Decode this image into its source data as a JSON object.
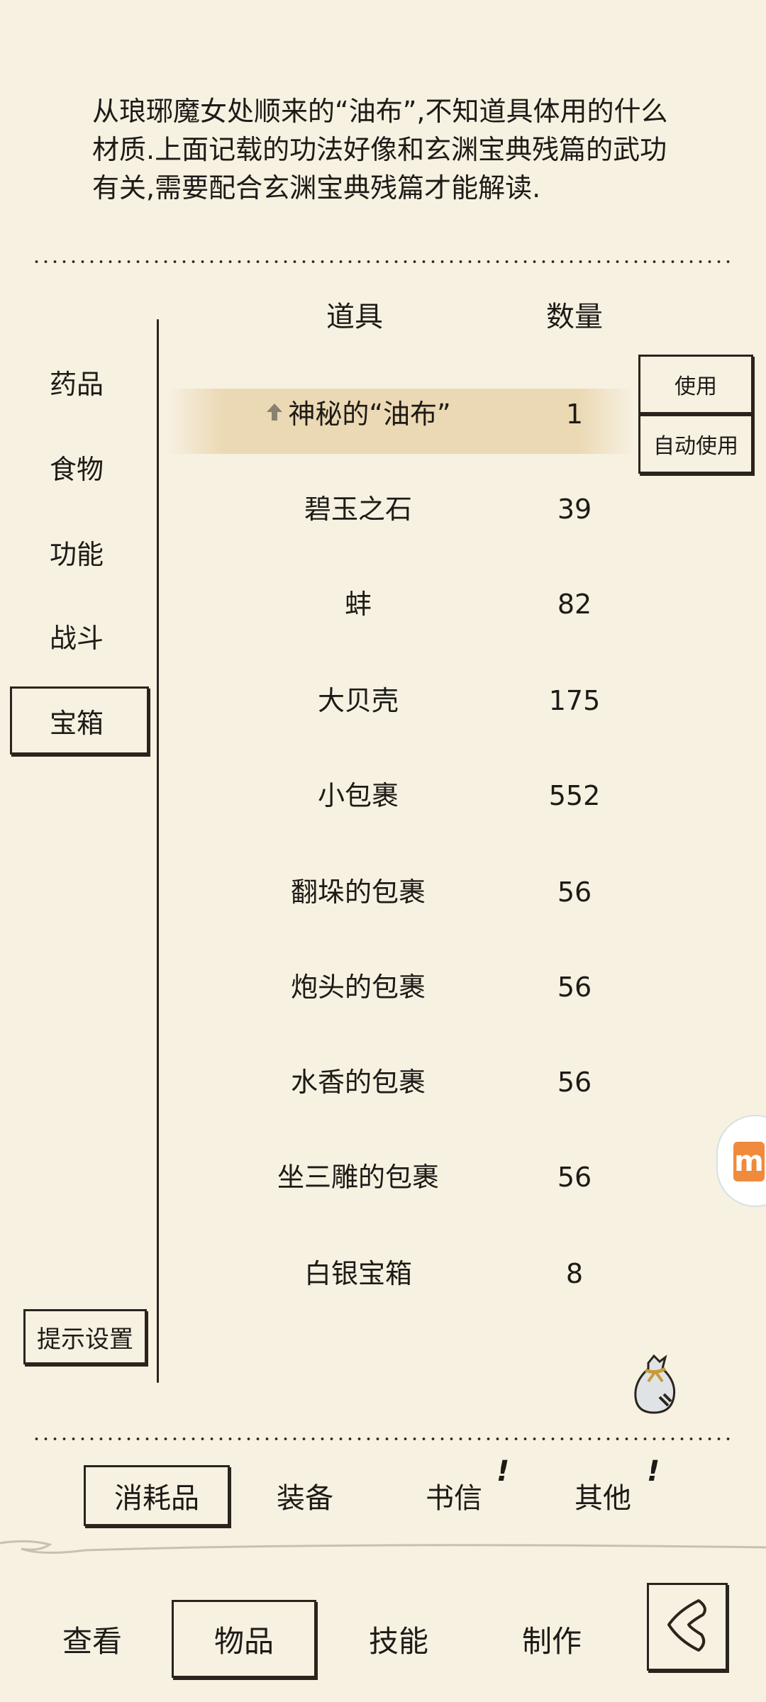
{
  "item_description": "从琅琊魔女处顺来的“油布”,不知道具体用的什么材质.上面记载的功法好像和玄渊宝典残篇的武功有关,需要配合玄渊宝典残篇才能解读.",
  "categories": [
    {
      "label": "药品"
    },
    {
      "label": "食物"
    },
    {
      "label": "功能"
    },
    {
      "label": "战斗"
    },
    {
      "label": "宝箱"
    }
  ],
  "selected_category": "宝箱",
  "hint_settings_label": "提示设置",
  "table": {
    "headers": {
      "name": "道具",
      "quantity": "数量"
    },
    "rows": [
      {
        "name": "神秘的“油布”",
        "quantity": "1"
      },
      {
        "name": "碧玉之石",
        "quantity": "39"
      },
      {
        "name": "蚌",
        "quantity": "82"
      },
      {
        "name": "大贝壳",
        "quantity": "175"
      },
      {
        "name": "小包裹",
        "quantity": "552"
      },
      {
        "name": "翻垛的包裹",
        "quantity": "56"
      },
      {
        "name": "炮头的包裹",
        "quantity": "56"
      },
      {
        "name": "水香的包裹",
        "quantity": "56"
      },
      {
        "name": "坐三雕的包裹",
        "quantity": "56"
      },
      {
        "name": "白银宝箱",
        "quantity": "8"
      }
    ]
  },
  "actions": {
    "use_label": "使用",
    "auto_use_label": "自动使用"
  },
  "item_tabs": [
    {
      "label": "消耗品"
    },
    {
      "label": "装备"
    },
    {
      "label": "书信"
    },
    {
      "label": "其他"
    }
  ],
  "notification_mark": "!",
  "bottom_nav": [
    {
      "label": "查看"
    },
    {
      "label": "物品"
    },
    {
      "label": "技能"
    },
    {
      "label": "制作"
    }
  ],
  "icons": {
    "back": "back-chevron-icon",
    "pin": "up-arrow-icon",
    "bag": "loot-bag-icon",
    "floating": "floating-m-icon"
  },
  "colors": {
    "background": "#f7f1e2",
    "ink": "#2a241d",
    "highlight": "#eadab2",
    "floating_accent": "#f08a3c"
  }
}
